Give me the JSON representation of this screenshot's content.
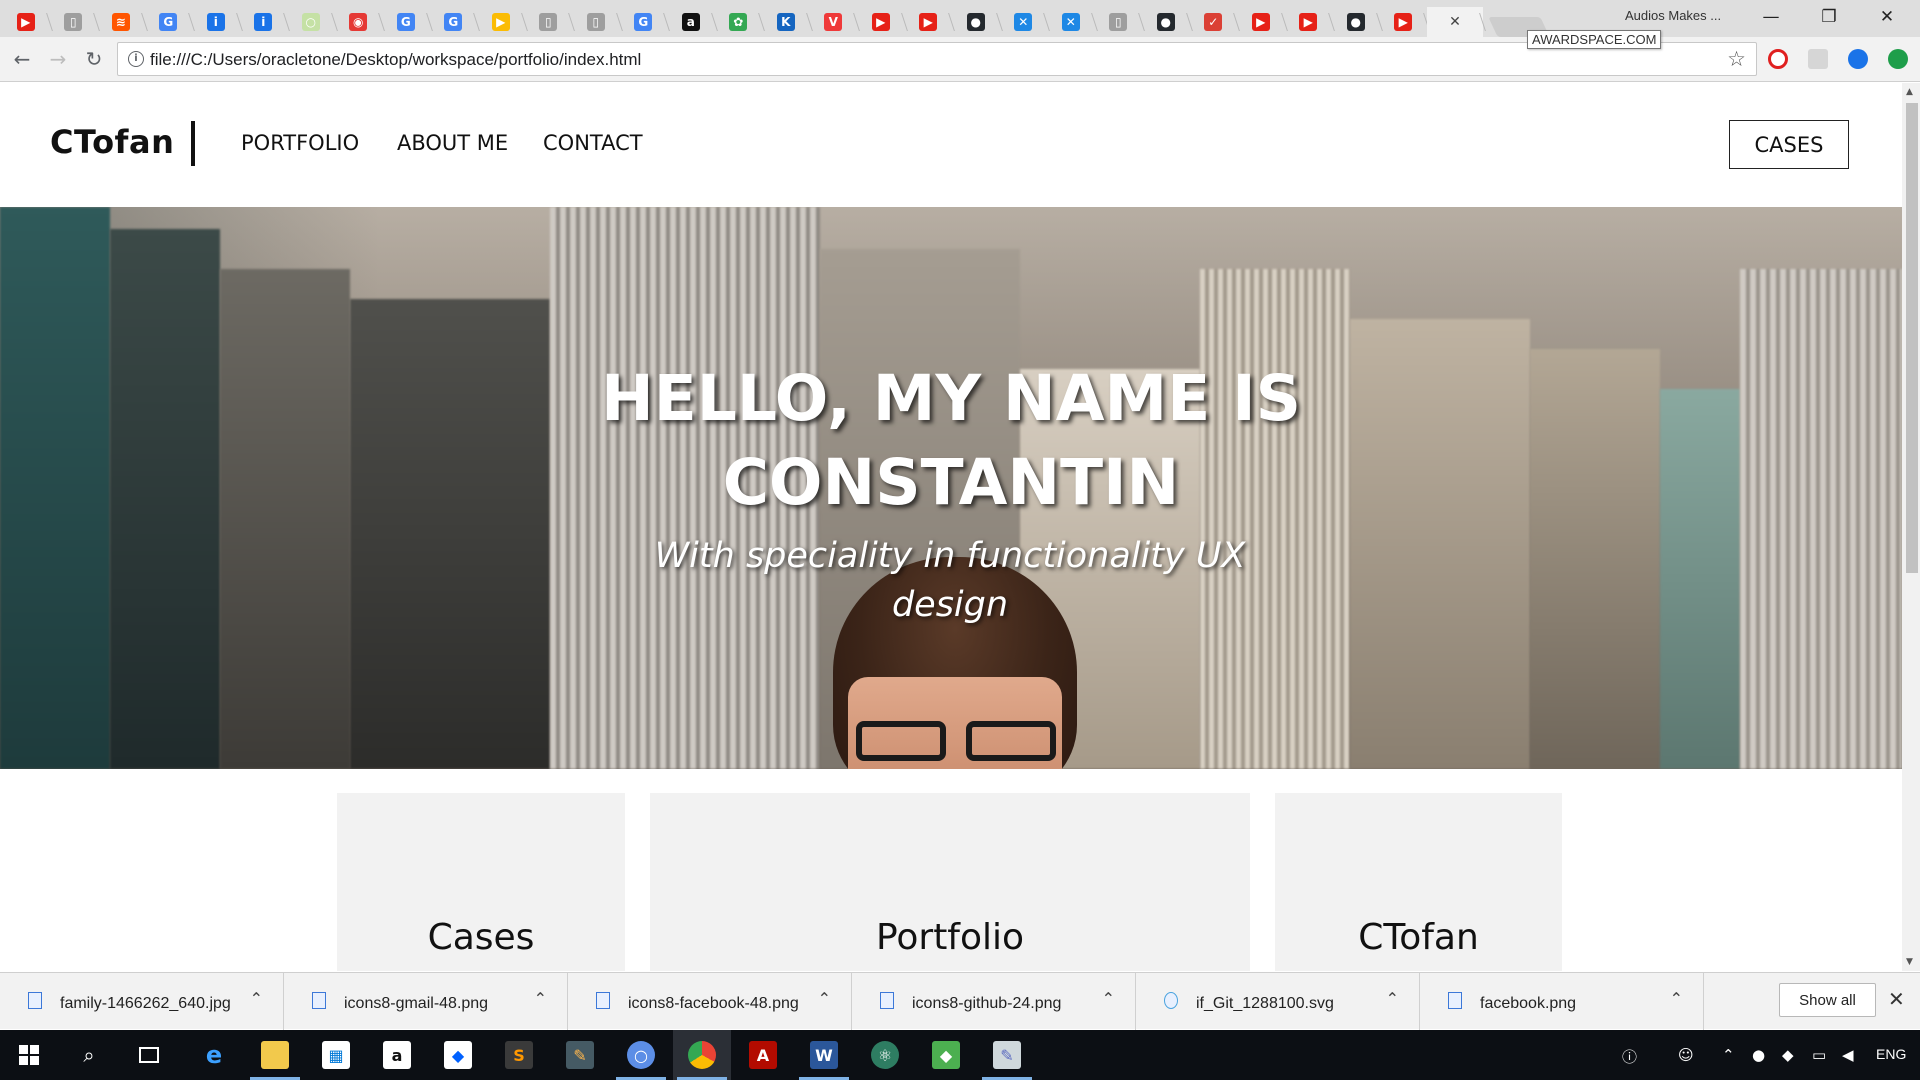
{
  "browser": {
    "tabs": [
      {
        "icon": "youtube-icon",
        "color": "#e62117",
        "glyph": "▶"
      },
      {
        "icon": "page-icon",
        "color": "#9e9e9e",
        "glyph": "▯"
      },
      {
        "icon": "soundcloud-icon",
        "color": "#ff5500",
        "glyph": "≋"
      },
      {
        "icon": "google-icon",
        "color": "#4285f4",
        "glyph": "G"
      },
      {
        "icon": "info-icon",
        "color": "#1a73e8",
        "glyph": "i"
      },
      {
        "icon": "info-icon",
        "color": "#1a73e8",
        "glyph": "i"
      },
      {
        "icon": "circle-icon",
        "color": "#c5e1a5",
        "glyph": "○"
      },
      {
        "icon": "record-icon",
        "color": "#e53935",
        "glyph": "◉"
      },
      {
        "icon": "google-icon",
        "color": "#4285f4",
        "glyph": "G"
      },
      {
        "icon": "google-icon",
        "color": "#4285f4",
        "glyph": "G"
      },
      {
        "icon": "play-icon",
        "color": "#fbbc04",
        "glyph": "▶"
      },
      {
        "icon": "page-icon",
        "color": "#9e9e9e",
        "glyph": "▯"
      },
      {
        "icon": "page-icon",
        "color": "#9e9e9e",
        "glyph": "▯"
      },
      {
        "icon": "google-icon",
        "color": "#4285f4",
        "glyph": "G"
      },
      {
        "icon": "amazon-icon",
        "color": "#111111",
        "glyph": "a"
      },
      {
        "icon": "clover-icon",
        "color": "#34a853",
        "glyph": "✿"
      },
      {
        "icon": "k-icon",
        "color": "#1565c0",
        "glyph": "K"
      },
      {
        "icon": "vivaldi-icon",
        "color": "#ef3939",
        "glyph": "V"
      },
      {
        "icon": "youtube-icon",
        "color": "#e62117",
        "glyph": "▶"
      },
      {
        "icon": "youtube-icon",
        "color": "#e62117",
        "glyph": "▶"
      },
      {
        "icon": "github-icon",
        "color": "#24292e",
        "glyph": "●"
      },
      {
        "icon": "x-box-icon",
        "color": "#1e88e5",
        "glyph": "✕"
      },
      {
        "icon": "x-box-icon",
        "color": "#1e88e5",
        "glyph": "✕"
      },
      {
        "icon": "page-icon",
        "color": "#9e9e9e",
        "glyph": "▯"
      },
      {
        "icon": "github-icon",
        "color": "#24292e",
        "glyph": "●"
      },
      {
        "icon": "todoist-icon",
        "color": "#db4035",
        "glyph": "✓"
      },
      {
        "icon": "youtube-icon",
        "color": "#e62117",
        "glyph": "▶"
      },
      {
        "icon": "youtube-icon",
        "color": "#e62117",
        "glyph": "▶"
      },
      {
        "icon": "github-icon",
        "color": "#24292e",
        "glyph": "●"
      },
      {
        "icon": "youtube-icon",
        "color": "#e62117",
        "glyph": "▶"
      }
    ],
    "active_tab_close": "✕",
    "profile_name": "Audios Makes ...",
    "url": "file:///C:/Users/oracletone/Desktop/workspace/portfolio/index.html",
    "tooltip": "AWARDSPACE.COM",
    "window_controls": {
      "minimize": "—",
      "restore": "❐",
      "close": "✕"
    }
  },
  "site": {
    "brand": "CTofan",
    "nav": {
      "portfolio": "PORTFOLIO",
      "about": "ABOUT ME",
      "contact": "CONTACT"
    },
    "cases_button": "CASES",
    "hero": {
      "title_line1": "HELLO, MY NAME IS",
      "title_line2": "CONSTANTIN",
      "subtitle_line1": "With speciality in functionality UX",
      "subtitle_line2": "design"
    },
    "cards": {
      "cases": "Cases",
      "portfolio": "Portfolio",
      "ctofan": "CTofan"
    }
  },
  "downloads": {
    "items": [
      "family-1466262_640.jpg",
      "icons8-gmail-48.png",
      "icons8-facebook-48.png",
      "icons8-github-24.png",
      "if_Git_1288100.svg",
      "facebook.png"
    ],
    "show_all": "Show all"
  },
  "taskbar": {
    "language": "ENG"
  }
}
